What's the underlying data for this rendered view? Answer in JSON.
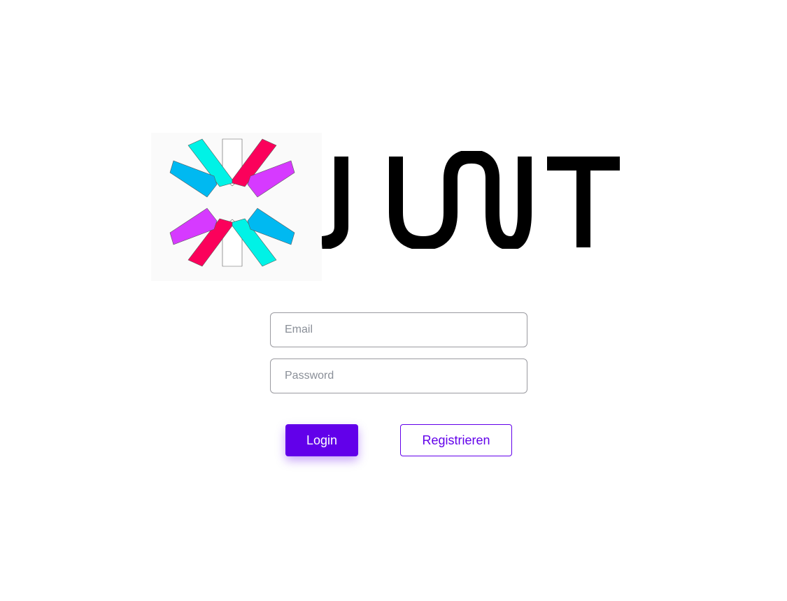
{
  "logo": {
    "wordmark_text": "JWT",
    "icon": "jwt-logo-icon",
    "colors": {
      "cyan": "#00f2e6",
      "pink": "#fb015b",
      "blue": "#00b9f1",
      "purple": "#d63aff",
      "black": "#000000"
    }
  },
  "form": {
    "email": {
      "placeholder": "Email",
      "value": ""
    },
    "password": {
      "placeholder": "Password",
      "value": ""
    }
  },
  "actions": {
    "login_label": "Login",
    "register_label": "Registrieren"
  },
  "theme": {
    "primary": "#6200ea",
    "field_border": "#9a9aa0",
    "placeholder": "#8a8f98"
  }
}
